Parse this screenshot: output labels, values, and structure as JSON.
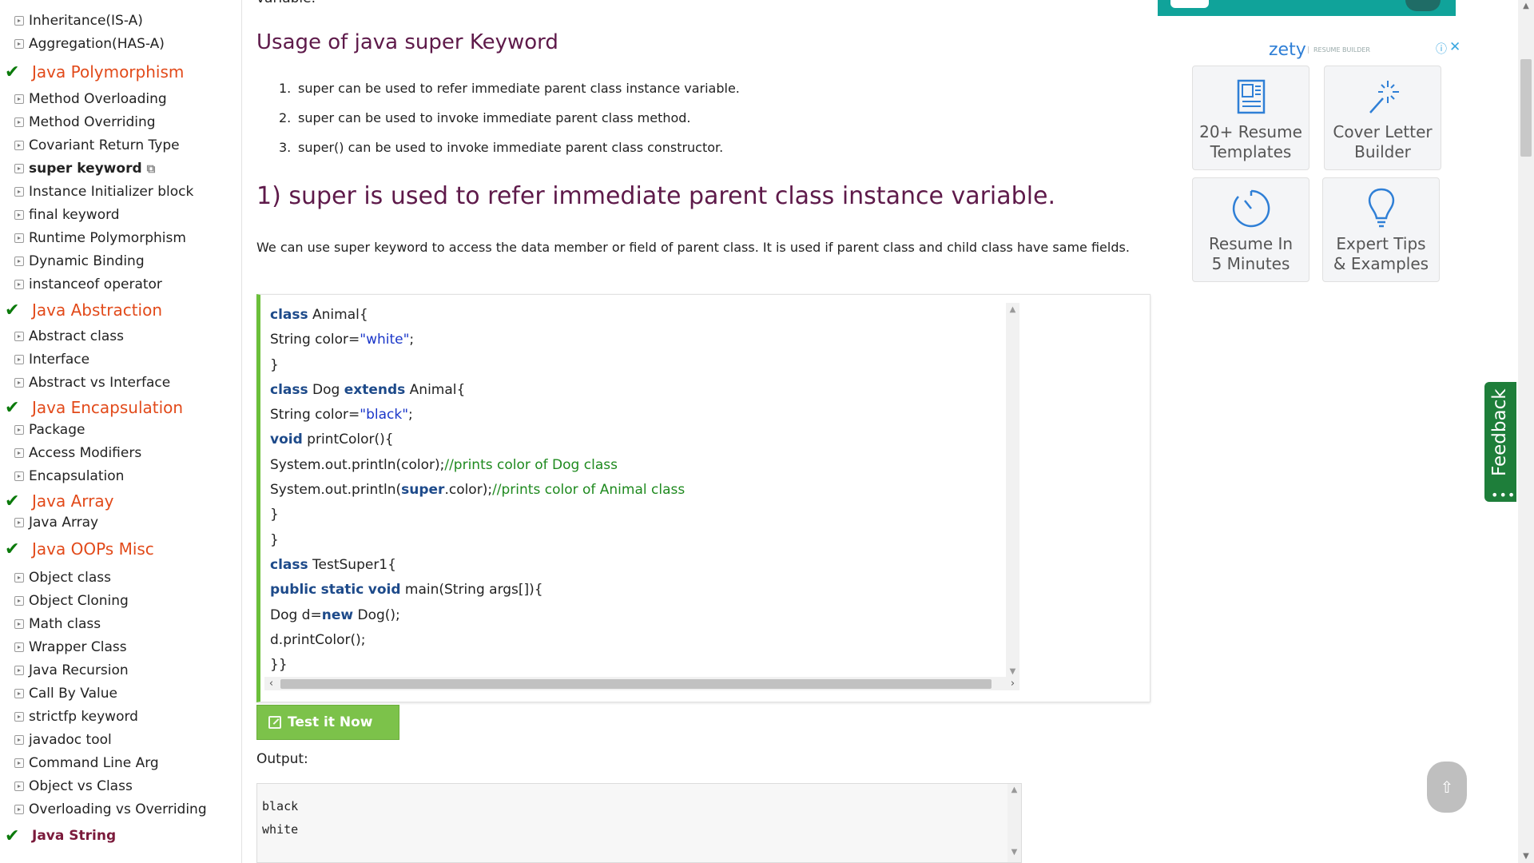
{
  "sidebar": {
    "items": [
      {
        "label": "Inheritance(IS-A)",
        "kind": "item"
      },
      {
        "label": "Aggregation(HAS-A)",
        "kind": "item"
      },
      {
        "label": "Java Polymorphism",
        "kind": "head"
      },
      {
        "label": "Method Overloading",
        "kind": "item"
      },
      {
        "label": "Method Overriding",
        "kind": "item"
      },
      {
        "label": "Covariant Return Type",
        "kind": "item"
      },
      {
        "label": "super keyword",
        "kind": "current"
      },
      {
        "label": "Instance Initializer block",
        "kind": "item"
      },
      {
        "label": "final keyword",
        "kind": "item"
      },
      {
        "label": "Runtime Polymorphism",
        "kind": "item"
      },
      {
        "label": "Dynamic Binding",
        "kind": "item"
      },
      {
        "label": "instanceof operator",
        "kind": "item"
      },
      {
        "label": "Java Abstraction",
        "kind": "head"
      },
      {
        "label": "Abstract class",
        "kind": "item"
      },
      {
        "label": "Interface",
        "kind": "item"
      },
      {
        "label": "Abstract vs Interface",
        "kind": "item"
      },
      {
        "label": "Java Encapsulation",
        "kind": "head"
      },
      {
        "label": "Package",
        "kind": "item"
      },
      {
        "label": "Access Modifiers",
        "kind": "item"
      },
      {
        "label": "Encapsulation",
        "kind": "item"
      },
      {
        "label": "Java Array",
        "kind": "head"
      },
      {
        "label": "Java Array",
        "kind": "item"
      },
      {
        "label": "Java OOPs Misc",
        "kind": "head"
      },
      {
        "label": "Object class",
        "kind": "item"
      },
      {
        "label": "Object Cloning",
        "kind": "item"
      },
      {
        "label": "Math class",
        "kind": "item"
      },
      {
        "label": "Wrapper Class",
        "kind": "item"
      },
      {
        "label": "Java Recursion",
        "kind": "item"
      },
      {
        "label": "Call By Value",
        "kind": "item"
      },
      {
        "label": "strictfp keyword",
        "kind": "item"
      },
      {
        "label": "javadoc tool",
        "kind": "item"
      },
      {
        "label": "Command Line Arg",
        "kind": "item"
      },
      {
        "label": "Object vs Class",
        "kind": "item"
      },
      {
        "label": "Overloading vs Overriding",
        "kind": "item"
      },
      {
        "label": "Java String",
        "kind": "head-small"
      }
    ]
  },
  "main": {
    "top_cut_text": "variable.",
    "usage_heading": "Usage of java super Keyword",
    "usage_list": [
      "super can be used to refer immediate parent class instance variable.",
      "super can be used to invoke immediate parent class method.",
      "super() can be used to invoke immediate parent class constructor."
    ],
    "section_heading": "1) super is used to refer immediate parent class instance variable.",
    "paragraph": "We can use super keyword to access the data member or field of parent class. It is used if parent class and child class have same fields.",
    "code_lines": [
      [
        [
          "kw",
          "class"
        ],
        [
          "t",
          " Animal{"
        ]
      ],
      [
        [
          "t",
          "String color="
        ],
        [
          "str",
          "\"white\""
        ],
        [
          "t",
          ";"
        ]
      ],
      [
        [
          "t",
          "}"
        ]
      ],
      [
        [
          "kw",
          "class"
        ],
        [
          "t",
          " Dog "
        ],
        [
          "kw",
          "extends"
        ],
        [
          "t",
          " Animal{"
        ]
      ],
      [
        [
          "t",
          "String color="
        ],
        [
          "str",
          "\"black\""
        ],
        [
          "t",
          ";"
        ]
      ],
      [
        [
          "kw",
          "void"
        ],
        [
          "t",
          " printColor(){"
        ]
      ],
      [
        [
          "t",
          "System.out.println(color);"
        ],
        [
          "cm",
          "//prints color of Dog class"
        ]
      ],
      [
        [
          "t",
          "System.out.println("
        ],
        [
          "kw",
          "super"
        ],
        [
          "t",
          ".color);"
        ],
        [
          "cm",
          "//prints color of Animal class"
        ]
      ],
      [
        [
          "t",
          "}"
        ]
      ],
      [
        [
          "t",
          "}"
        ]
      ],
      [
        [
          "kw",
          "class"
        ],
        [
          "t",
          " TestSuper1{"
        ]
      ],
      [
        [
          "kw",
          "public"
        ],
        [
          "t",
          " "
        ],
        [
          "kw",
          "static"
        ],
        [
          "t",
          " "
        ],
        [
          "kw",
          "void"
        ],
        [
          "t",
          " main(String args[]){"
        ]
      ],
      [
        [
          "t",
          "Dog d="
        ],
        [
          "kw",
          "new"
        ],
        [
          "t",
          " Dog();"
        ]
      ],
      [
        [
          "t",
          "d.printColor();"
        ]
      ],
      [
        [
          "t",
          "}}"
        ]
      ]
    ],
    "test_button_label": "Test it Now",
    "output_label": "Output:",
    "output_lines": [
      "black",
      "white"
    ]
  },
  "ad": {
    "brand": "zety",
    "brand_sub": "RESUME BUILDER",
    "info_icon": "info-icon",
    "close_icon": "close-icon",
    "tiles": [
      {
        "line1": "20+ Resume",
        "line2": "Templates",
        "icon": "template-icon"
      },
      {
        "line1": "Cover Letter",
        "line2": "Builder",
        "icon": "magic-wand-icon"
      },
      {
        "line1": "Resume In",
        "line2": "5 Minutes",
        "icon": "timer-icon"
      },
      {
        "line1": "Expert Tips",
        "line2": "& Examples",
        "icon": "lightbulb-icon"
      }
    ],
    "colors": {
      "accent": "#2f7fd6",
      "banner": "#10a39a"
    }
  },
  "feedback": {
    "label": "Feedback"
  },
  "scroll_top": {
    "icon": "arrow-up-icon"
  },
  "colors": {
    "heading": "#5e1a4a",
    "sidebar_head": "#e24a1a",
    "check": "#0b7a0b",
    "keyword": "#1d4a8a",
    "string": "#1a36c9",
    "comment": "#1f8a1f",
    "test_button": "#7cc24a",
    "code_border": "#6bbf3a",
    "feedback": "#1e7e3a"
  }
}
